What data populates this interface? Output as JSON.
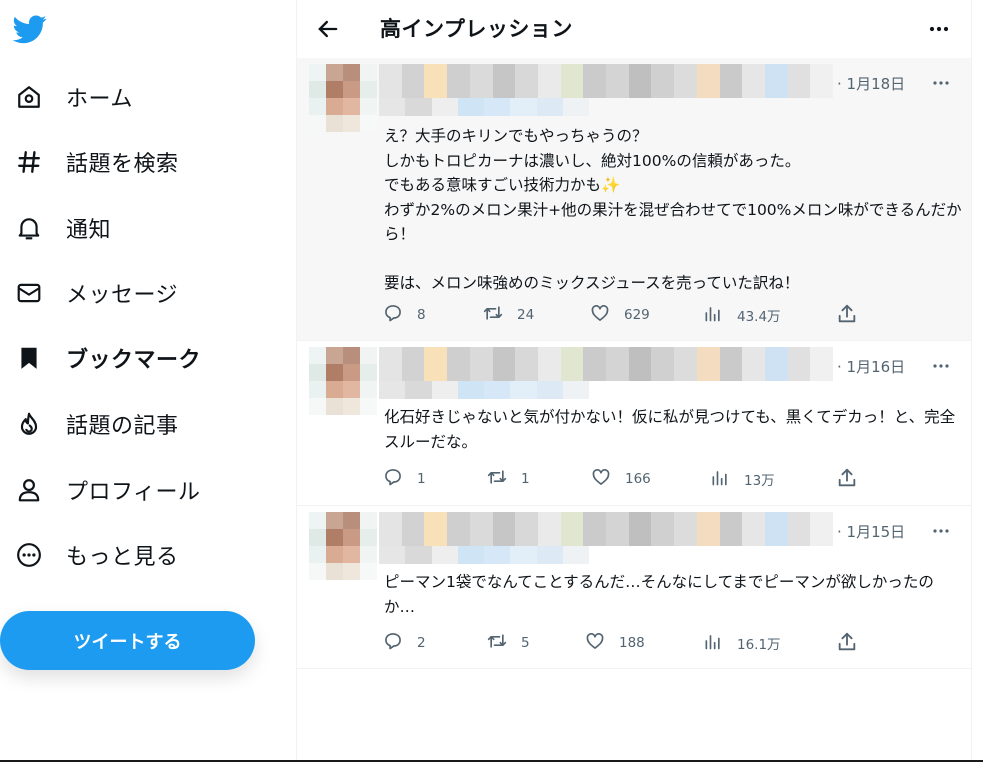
{
  "sidebar": {
    "logo_icon": "twitter-bird-icon",
    "nav": [
      {
        "label": "ホーム",
        "icon": "home-icon",
        "active": false
      },
      {
        "label": "話題を検索",
        "icon": "hashtag-icon",
        "active": false
      },
      {
        "label": "通知",
        "icon": "bell-icon",
        "active": false
      },
      {
        "label": "メッセージ",
        "icon": "mail-icon",
        "active": false
      },
      {
        "label": "ブックマーク",
        "icon": "bookmark-icon",
        "active": true
      },
      {
        "label": "話題の記事",
        "icon": "flame-icon",
        "active": false
      },
      {
        "label": "プロフィール",
        "icon": "person-icon",
        "active": false
      },
      {
        "label": "もっと見る",
        "icon": "more-circle-icon",
        "active": false
      }
    ],
    "tweet_button": "ツイートする"
  },
  "header": {
    "title": "高インプレッション",
    "back_icon": "arrow-left-icon",
    "more_icon": "more-horizontal-icon"
  },
  "tweets": [
    {
      "date": "· 1月18日",
      "text": "え？大手のキリンでもやっちゃうの？\nしかもトロピカーナは濃いし、絶対100%の信頼があった。\nでもある意味すごい技術力かも✨\nわずか2%のメロン果汁+他の果汁を混ぜ合わせてで100%メロン味ができるんだから！\n\n要は、メロン味強めのミックスジュースを売っていた訳ね！",
      "replies": "8",
      "retweets": "24",
      "likes": "629",
      "views": "43.4万"
    },
    {
      "date": "· 1月16日",
      "text": "化石好きじゃないと気が付かない！仮に私が見つけても、黒くてデカっ！と、完全スルーだな。",
      "replies": "1",
      "retweets": "1",
      "likes": "166",
      "views": "13万"
    },
    {
      "date": "· 1月15日",
      "text": "ピーマン1袋でなんてことするんだ…そんなにしてまでピーマンが欲しかったのか…",
      "replies": "2",
      "retweets": "5",
      "likes": "188",
      "views": "16.1万"
    }
  ],
  "colors": {
    "accent": "#1d9bf0",
    "text": "#0f1419",
    "secondary": "#536471"
  }
}
